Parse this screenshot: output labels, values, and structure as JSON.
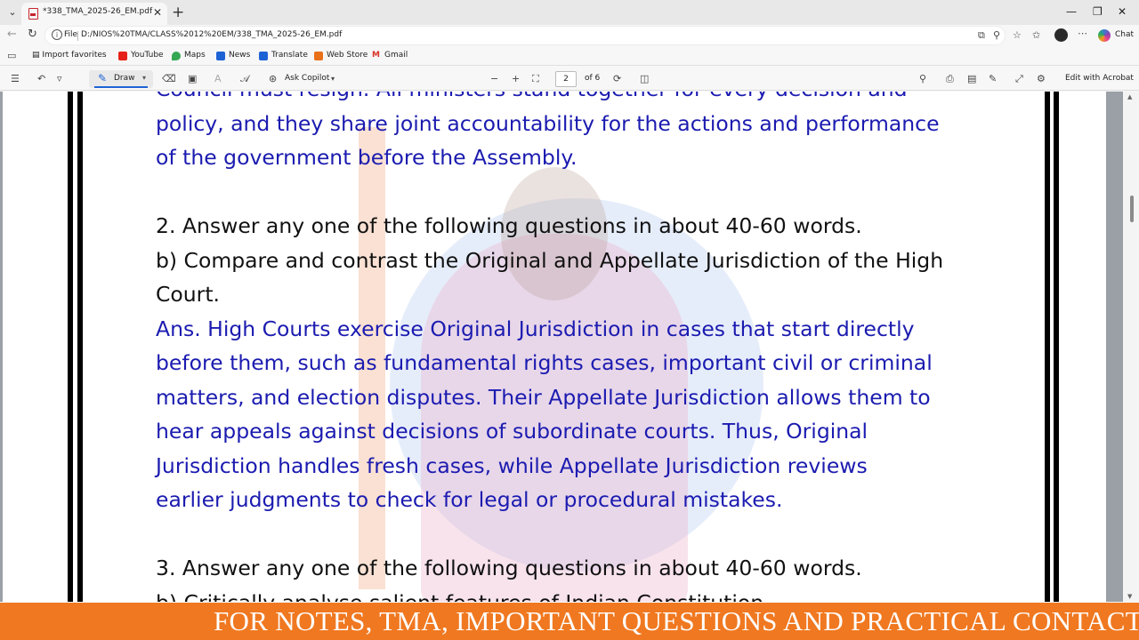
{
  "browser": {
    "tab_title": "*338_TMA_2025-26_EM.pdf",
    "address_scheme": "File",
    "address_url": "D:/NIOS%20TMA/CLASS%2012%20EM/338_TMA_2025-26_EM.pdf",
    "chat_label": "Chat"
  },
  "favorites": [
    {
      "label": "Import favorites",
      "icon": "import-icon"
    },
    {
      "label": "YouTube",
      "icon": "youtube-icon",
      "color": "#e62117"
    },
    {
      "label": "Maps",
      "icon": "maps-icon",
      "color": "#34a853"
    },
    {
      "label": "News",
      "icon": "news-icon",
      "color": "#1e63d6"
    },
    {
      "label": "Translate",
      "icon": "translate-icon",
      "color": "#1e63d6"
    },
    {
      "label": "Web Store",
      "icon": "webstore-icon",
      "color": "#e8711a"
    },
    {
      "label": "Gmail",
      "icon": "gmail-icon",
      "color": "#d93025"
    }
  ],
  "pdf_toolbar": {
    "draw_label": "Draw",
    "ask_copilot_label": "Ask Copilot",
    "page_current": "2",
    "page_total": "of 6",
    "edit_acrobat_label": "Edit with Acrobat"
  },
  "document": {
    "lines": [
      {
        "text": "Council must resign. All ministers stand together for every decision and",
        "color": "blue"
      },
      {
        "text": "policy, and they share joint accountability for the actions and performance",
        "color": "blue"
      },
      {
        "text": "of the government before the Assembly.",
        "color": "blue"
      },
      {
        "text": "",
        "color": "black"
      },
      {
        "text": "2. Answer any one of the following questions in about 40-60 words.",
        "color": "black"
      },
      {
        "text": "b) Compare and contrast the Original and Appellate Jurisdiction of the High",
        "color": "black"
      },
      {
        "text": "Court.",
        "color": "black"
      },
      {
        "text": "Ans. High Courts exercise Original Jurisdiction in cases that start directly",
        "color": "blue"
      },
      {
        "text": "before them, such as fundamental rights cases, important civil or criminal",
        "color": "blue"
      },
      {
        "text": "matters, and election disputes. Their Appellate Jurisdiction allows them to",
        "color": "blue"
      },
      {
        "text": "hear appeals against decisions of subordinate courts. Thus, Original",
        "color": "blue"
      },
      {
        "text": "Jurisdiction handles fresh cases, while Appellate Jurisdiction reviews",
        "color": "blue"
      },
      {
        "text": "earlier judgments to check for legal or procedural mistakes.",
        "color": "blue"
      },
      {
        "text": "",
        "color": "black"
      },
      {
        "text": "3. Answer any one of the following questions in about 40-60 words.",
        "color": "black"
      },
      {
        "text": "b) Critically analyse salient features of Indian Constitution.",
        "color": "black"
      }
    ]
  },
  "banner": {
    "text": "FOR NOTES, TMA, IMPORTANT QUESTIONS AND PRACTICAL CONTACT"
  },
  "colors": {
    "answer_text": "#1b1bb0",
    "question_text": "#111111",
    "banner_bg": "#f07820",
    "accent": "#1e63d6"
  }
}
